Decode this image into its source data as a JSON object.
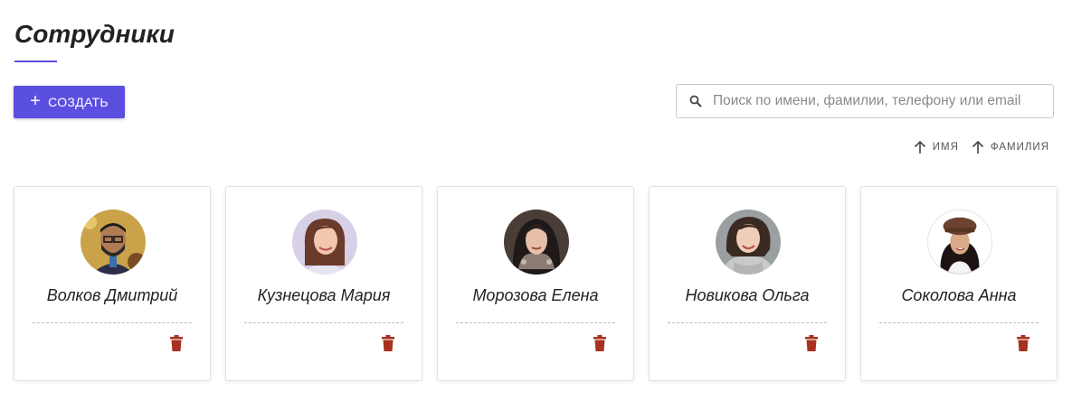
{
  "page": {
    "title": "Сотрудники",
    "accent_color": "#5b4fe0"
  },
  "toolbar": {
    "create_label": "Создать",
    "create_icon": "plus-icon"
  },
  "search": {
    "placeholder": "Поиск по имени, фамилии, телефону или email",
    "value": "",
    "icon": "search-icon"
  },
  "sort": [
    {
      "label": "имя",
      "icon": "arrow-up-icon"
    },
    {
      "label": "фамилия",
      "icon": "arrow-up-icon"
    }
  ],
  "employees": [
    {
      "name": "Волков Дмитрий",
      "delete_icon": "trash-icon"
    },
    {
      "name": "Кузнецова Мария",
      "delete_icon": "trash-icon"
    },
    {
      "name": "Морозова Елена",
      "delete_icon": "trash-icon"
    },
    {
      "name": "Новикова Ольга",
      "delete_icon": "trash-icon"
    },
    {
      "name": "Соколова Анна",
      "delete_icon": "trash-icon"
    }
  ],
  "colors": {
    "delete": "#a8321f",
    "card_border": "#e2e2e2"
  }
}
